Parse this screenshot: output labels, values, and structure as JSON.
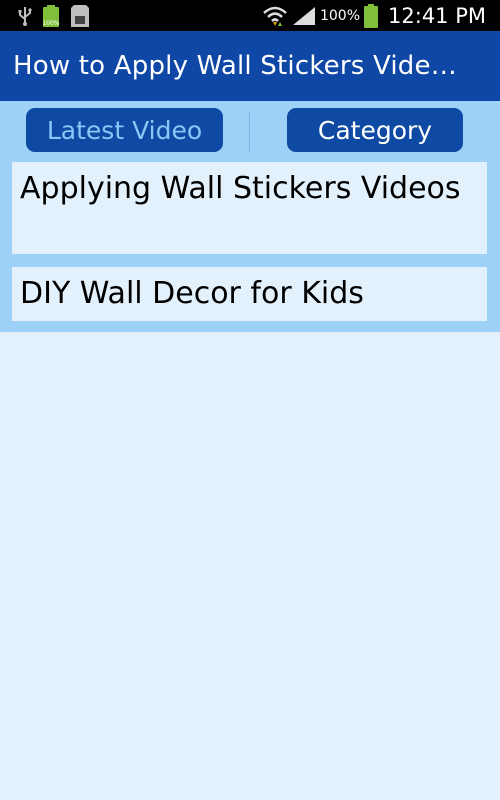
{
  "status_bar": {
    "battery_percent": "100%",
    "time": "12:41 PM",
    "icons": [
      "usb-icon",
      "battery-status-icon",
      "sd-card-icon",
      "wifi-icon",
      "signal-icon",
      "battery-icon"
    ]
  },
  "app_bar": {
    "title": "How to Apply Wall Stickers Vide…"
  },
  "tabs": {
    "latest_label": "Latest Video",
    "category_label": "Category"
  },
  "list": {
    "items": [
      {
        "label": "Applying Wall Stickers Videos"
      },
      {
        "label": "DIY Wall Decor for Kids"
      }
    ]
  },
  "colors": {
    "app_bar": "#0f47a6",
    "panel": "#9ed1f8",
    "background": "#e3f1fc",
    "tab_active_text": "#86c8f6"
  }
}
